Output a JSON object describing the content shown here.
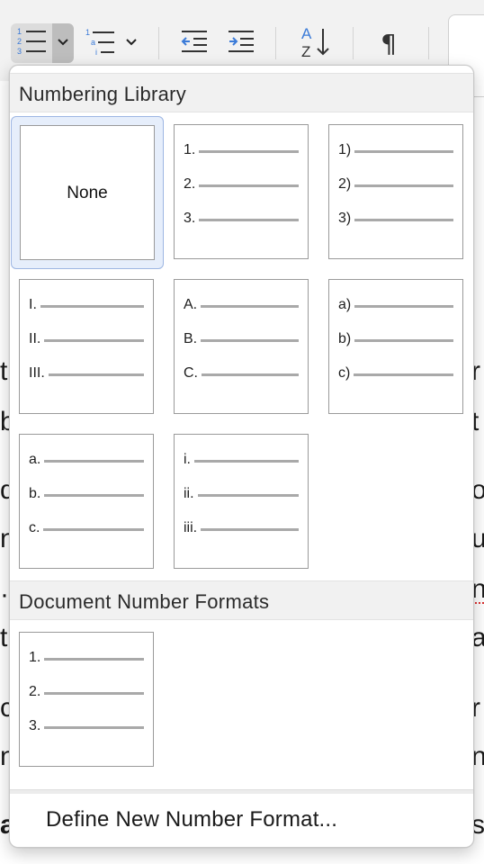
{
  "toolbar": {
    "buttons": [
      {
        "name": "numbering-button",
        "icon": "numbered-list-icon"
      },
      {
        "name": "numbering-dropdown-button",
        "icon": "chevron-down-icon"
      },
      {
        "name": "multilevel-list-button",
        "icon": "multilevel-list-icon"
      },
      {
        "name": "multilevel-dropdown-button",
        "icon": "chevron-down-icon"
      },
      {
        "name": "decrease-indent-button",
        "icon": "decrease-indent-icon"
      },
      {
        "name": "increase-indent-button",
        "icon": "increase-indent-icon"
      },
      {
        "name": "sort-button",
        "icon": "sort-az-icon"
      },
      {
        "name": "show-formatting-button",
        "icon": "pilcrow-icon"
      }
    ],
    "accent_color": "#3b7bd8"
  },
  "background_text": [
    "t",
    "b",
    "d",
    "n.",
    "·",
    "t",
    "c",
    "n",
    "a",
    "r",
    "t",
    "o",
    "u",
    "n",
    "a",
    "r",
    "n",
    "s"
  ],
  "popover": {
    "library": {
      "title": "Numbering Library",
      "none_label": "None",
      "tiles": [
        {
          "labels": [
            "1.",
            "2.",
            "3."
          ]
        },
        {
          "labels": [
            "1)",
            "2)",
            "3)"
          ]
        },
        {
          "labels": [
            "I.",
            "II.",
            "III."
          ]
        },
        {
          "labels": [
            "A.",
            "B.",
            "C."
          ]
        },
        {
          "labels": [
            "a)",
            "b)",
            "c)"
          ]
        },
        {
          "labels": [
            "a.",
            "b.",
            "c."
          ]
        },
        {
          "labels": [
            "i.",
            "ii.",
            "iii."
          ]
        }
      ]
    },
    "document_formats": {
      "title": "Document Number Formats",
      "tiles": [
        {
          "labels": [
            "1.",
            "2.",
            "3."
          ]
        }
      ]
    },
    "define_label": "Define New Number Format..."
  }
}
